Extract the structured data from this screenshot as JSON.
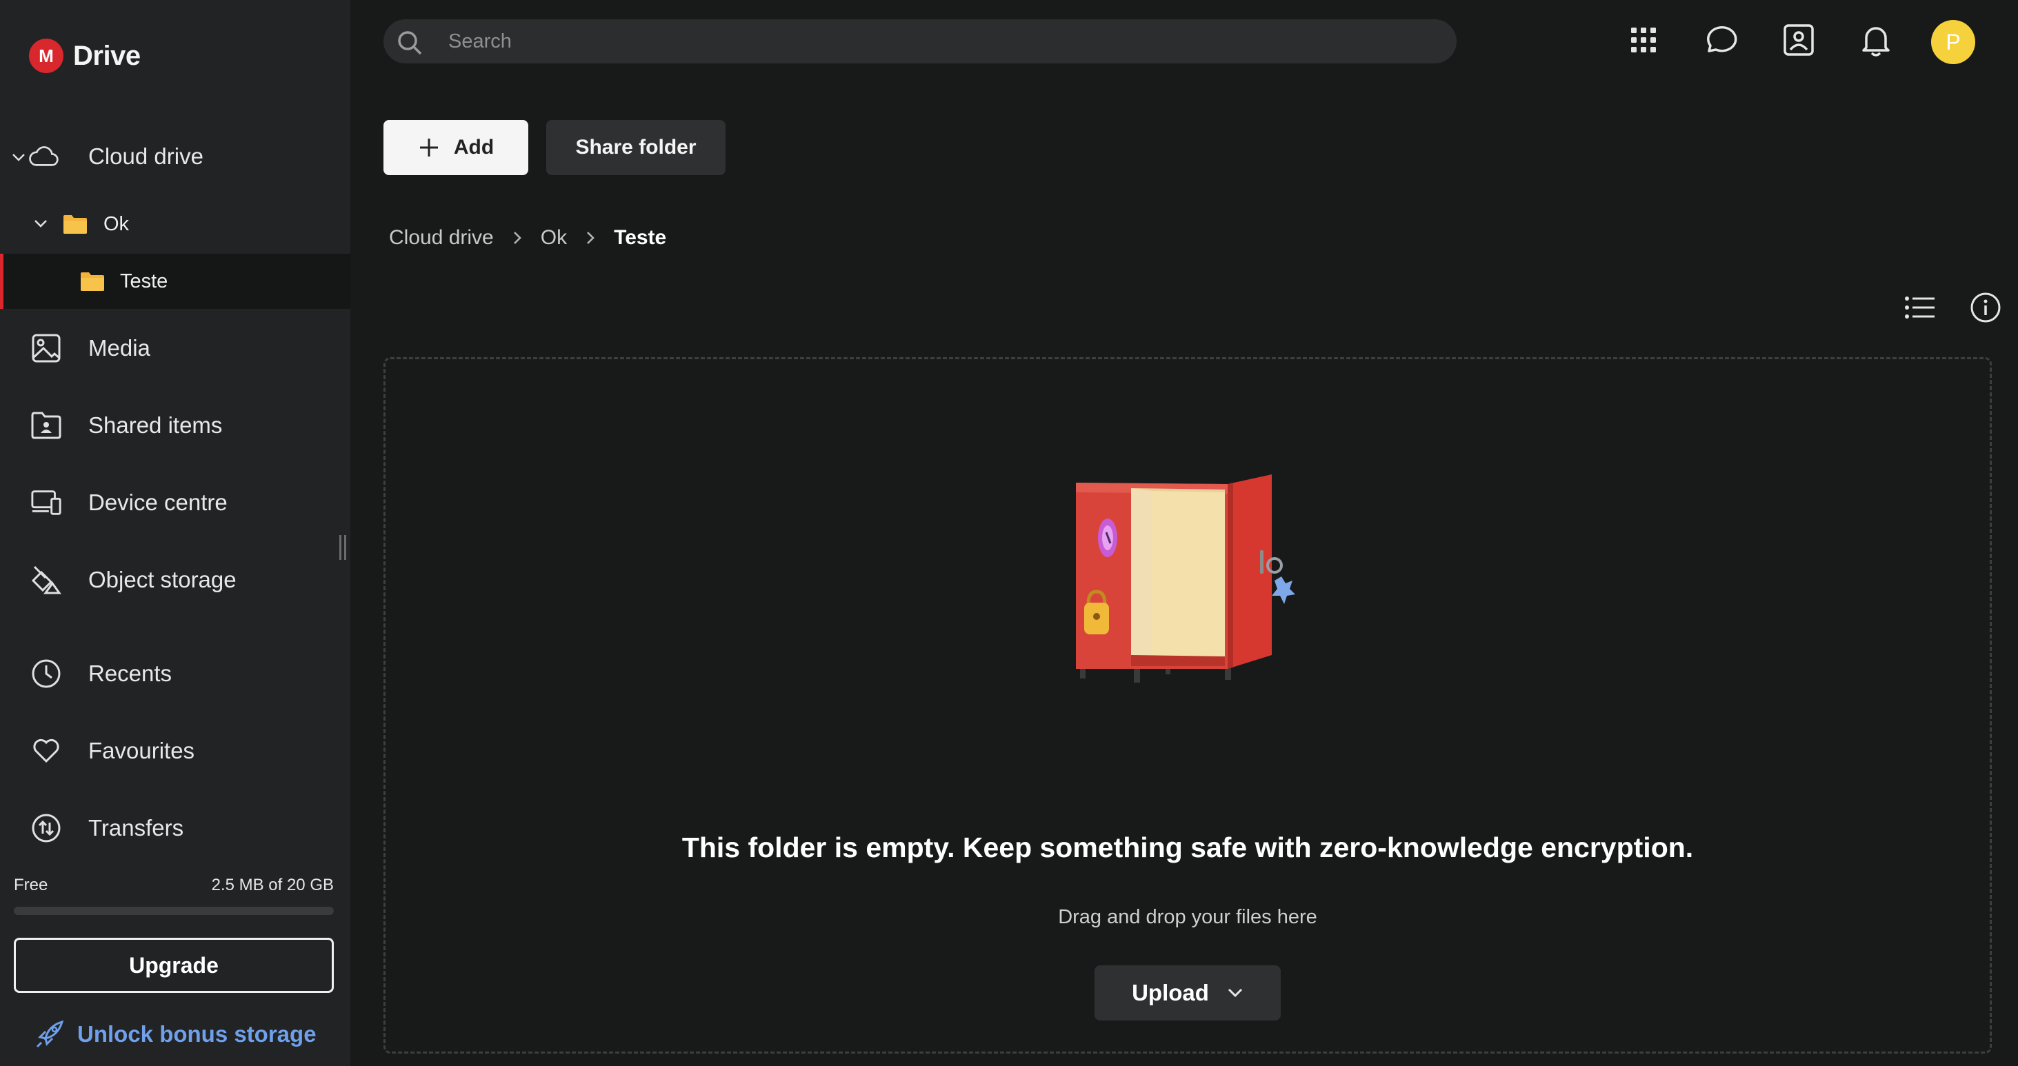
{
  "app": {
    "name": "Drive",
    "logo_letter": "M",
    "brand_color": "#d9272e"
  },
  "sidebar": {
    "cloud_drive": {
      "label": "Cloud drive",
      "icon": "cloud-icon"
    },
    "tree": [
      {
        "label": "Ok",
        "icon": "folder-icon",
        "expanded": true
      },
      {
        "label": "Teste",
        "icon": "folder-icon",
        "selected": true
      }
    ],
    "items": [
      {
        "label": "Media",
        "icon": "image-icon"
      },
      {
        "label": "Shared items",
        "icon": "shared-folder-icon"
      },
      {
        "label": "Device centre",
        "icon": "devices-icon"
      },
      {
        "label": "Object storage",
        "icon": "object-storage-icon"
      },
      {
        "label": "Recents",
        "icon": "clock-icon"
      },
      {
        "label": "Favourites",
        "icon": "heart-icon"
      },
      {
        "label": "Transfers",
        "icon": "transfers-icon"
      }
    ],
    "storage": {
      "plan": "Free",
      "used_text": "2.5 MB of 20 GB",
      "used_fraction": 0.000125
    },
    "upgrade_label": "Upgrade",
    "unlock_label": "Unlock bonus storage"
  },
  "topbar": {
    "search_placeholder": "Search",
    "icons": [
      "apps-grid-icon",
      "chat-icon",
      "contacts-icon",
      "bell-icon"
    ],
    "avatar_initial": "P",
    "avatar_color": "#f5d23b"
  },
  "toolbar": {
    "add_label": "Add",
    "share_label": "Share folder"
  },
  "breadcrumb": [
    "Cloud drive",
    "Ok",
    "Teste"
  ],
  "empty_state": {
    "title": "This folder is empty. Keep something safe with zero-knowledge encryption.",
    "subtitle": "Drag and drop your files here",
    "upload_label": "Upload"
  }
}
